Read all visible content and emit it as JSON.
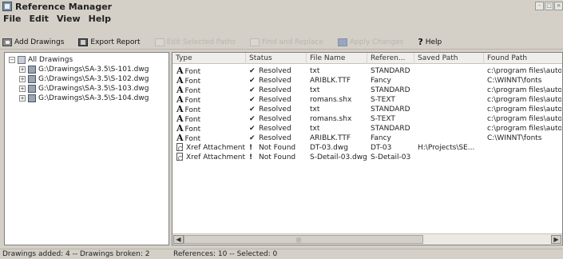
{
  "window": {
    "title": "Reference Manager",
    "controls": [
      "-",
      "□",
      "×"
    ]
  },
  "menu": [
    "File",
    "Edit",
    "View",
    "Help"
  ],
  "toolbar": {
    "add_drawings": "Add Drawings",
    "export_report": "Export Report",
    "edit_selected_paths": "Edit Selected Paths",
    "find_and_replace": "Find and Replace",
    "apply_changes": "Apply Changes",
    "help": "Help"
  },
  "tree": {
    "root": "All Drawings",
    "drawings": [
      "G:\\Drawings\\SA-3.5\\S-101.dwg",
      "G:\\Drawings\\SA-3.5\\S-102.dwg",
      "G:\\Drawings\\SA-3.5\\S-103.dwg",
      "G:\\Drawings\\SA-3.5\\S-104.dwg"
    ]
  },
  "grid": {
    "columns": [
      "Type",
      "Status",
      "File Name",
      "Referen...",
      "Saved Path",
      "Found Path"
    ],
    "rows": [
      {
        "kind": "font",
        "type": "Font",
        "status_mark": "✔",
        "status": "Resolved",
        "file": "txt",
        "ref": "STANDARD",
        "saved": "",
        "found": "c:\\program files\\autoca"
      },
      {
        "kind": "font",
        "type": "Font",
        "status_mark": "✔",
        "status": "Resolved",
        "file": "ARIBLK.TTF",
        "ref": "Fancy",
        "saved": "",
        "found": "C:\\WINNT\\fonts"
      },
      {
        "kind": "font",
        "type": "Font",
        "status_mark": "✔",
        "status": "Resolved",
        "file": "txt",
        "ref": "STANDARD",
        "saved": "",
        "found": "c:\\program files\\autoca"
      },
      {
        "kind": "font",
        "type": "Font",
        "status_mark": "✔",
        "status": "Resolved",
        "file": "romans.shx",
        "ref": "S-TEXT",
        "saved": "",
        "found": "c:\\program files\\autoca"
      },
      {
        "kind": "font",
        "type": "Font",
        "status_mark": "✔",
        "status": "Resolved",
        "file": "txt",
        "ref": "STANDARD",
        "saved": "",
        "found": "c:\\program files\\autoca"
      },
      {
        "kind": "font",
        "type": "Font",
        "status_mark": "✔",
        "status": "Resolved",
        "file": "romans.shx",
        "ref": "S-TEXT",
        "saved": "",
        "found": "c:\\program files\\autoca"
      },
      {
        "kind": "font",
        "type": "Font",
        "status_mark": "✔",
        "status": "Resolved",
        "file": "txt",
        "ref": "STANDARD",
        "saved": "",
        "found": "c:\\program files\\autoca"
      },
      {
        "kind": "font",
        "type": "Font",
        "status_mark": "✔",
        "status": "Resolved",
        "file": "ARIBLK.TTF",
        "ref": "Fancy",
        "saved": "",
        "found": "C:\\WINNT\\fonts"
      },
      {
        "kind": "xref",
        "type": "Xref Attachment",
        "status_mark": "!",
        "status": "Not Found",
        "file": "DT-03.dwg",
        "ref": "DT-03",
        "saved": "H:\\Projects\\SE...",
        "found": ""
      },
      {
        "kind": "xref",
        "type": "Xref Attachment",
        "status_mark": "!",
        "status": "Not Found",
        "file": "S-Detail-03.dwg",
        "ref": "S-Detail-03",
        "saved": "",
        "found": ""
      }
    ]
  },
  "status": {
    "drawings": "Drawings added: 4 -- Drawings broken: 2",
    "references": "References: 10 -- Selected: 0"
  }
}
